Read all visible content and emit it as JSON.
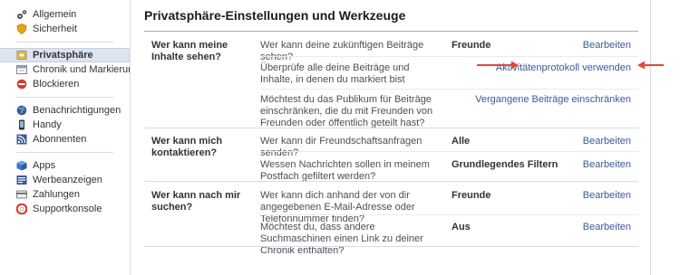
{
  "sidebar": {
    "groups": [
      [
        {
          "label": "Allgemein",
          "icon": "gears-icon"
        },
        {
          "label": "Sicherheit",
          "icon": "badge-icon"
        }
      ],
      [
        {
          "label": "Privatsphäre",
          "icon": "privacy-icon",
          "active": true
        },
        {
          "label": "Chronik und Markierung…",
          "icon": "timeline-icon"
        },
        {
          "label": "Blockieren",
          "icon": "block-icon"
        }
      ],
      [
        {
          "label": "Benachrichtigungen",
          "icon": "globe-icon"
        },
        {
          "label": "Handy",
          "icon": "phone-icon"
        },
        {
          "label": "Abonnenten",
          "icon": "rss-icon"
        }
      ],
      [
        {
          "label": "Apps",
          "icon": "apps-icon"
        },
        {
          "label": "Werbeanzeigen",
          "icon": "ads-icon"
        },
        {
          "label": "Zahlungen",
          "icon": "card-icon"
        },
        {
          "label": "Supportkonsole",
          "icon": "support-icon"
        }
      ]
    ]
  },
  "page": {
    "title": "Privatsphäre-Einstellungen und Werkzeuge"
  },
  "sections": [
    {
      "heading": "Wer kann meine Inhalte sehen?",
      "rows": [
        {
          "question": "Wer kann deine zukünftigen Beiträge sehen?",
          "value": "Freunde",
          "action": "Bearbeiten"
        },
        {
          "question": "Überprüfe alle deine Beiträge und Inhalte, in denen du markiert bist",
          "value": "",
          "action": "Aktivitätenprotokoll verwenden"
        },
        {
          "question": "Möchtest du das Publikum für Beiträge einschränken, die du mit Freunden von Freunden oder öffentlich geteilt hast?",
          "value": "",
          "action": "Vergangene Beiträge einschränken"
        }
      ]
    },
    {
      "heading": "Wer kann mich kontaktieren?",
      "rows": [
        {
          "question": "Wer kann dir Freundschaftsanfragen senden?",
          "value": "Alle",
          "action": "Bearbeiten"
        },
        {
          "question": "Wessen Nachrichten sollen in meinem Postfach gefiltert werden?",
          "value": "Grundlegendes Filtern",
          "action": "Bearbeiten"
        }
      ]
    },
    {
      "heading": "Wer kann nach mir suchen?",
      "rows": [
        {
          "question": "Wer kann dich anhand der von dir angegebenen E-Mail-Adresse oder Telefonnummer finden?",
          "value": "Freunde",
          "action": "Bearbeiten"
        },
        {
          "question": "Möchtest du, dass andere Suchmaschinen einen Link zu deiner Chronik enthalten?",
          "value": "Aus",
          "action": "Bearbeiten"
        }
      ]
    }
  ],
  "colors": {
    "link": "#3b5998",
    "arrow": "#e0473a",
    "active_bg": "#dde3ef"
  }
}
